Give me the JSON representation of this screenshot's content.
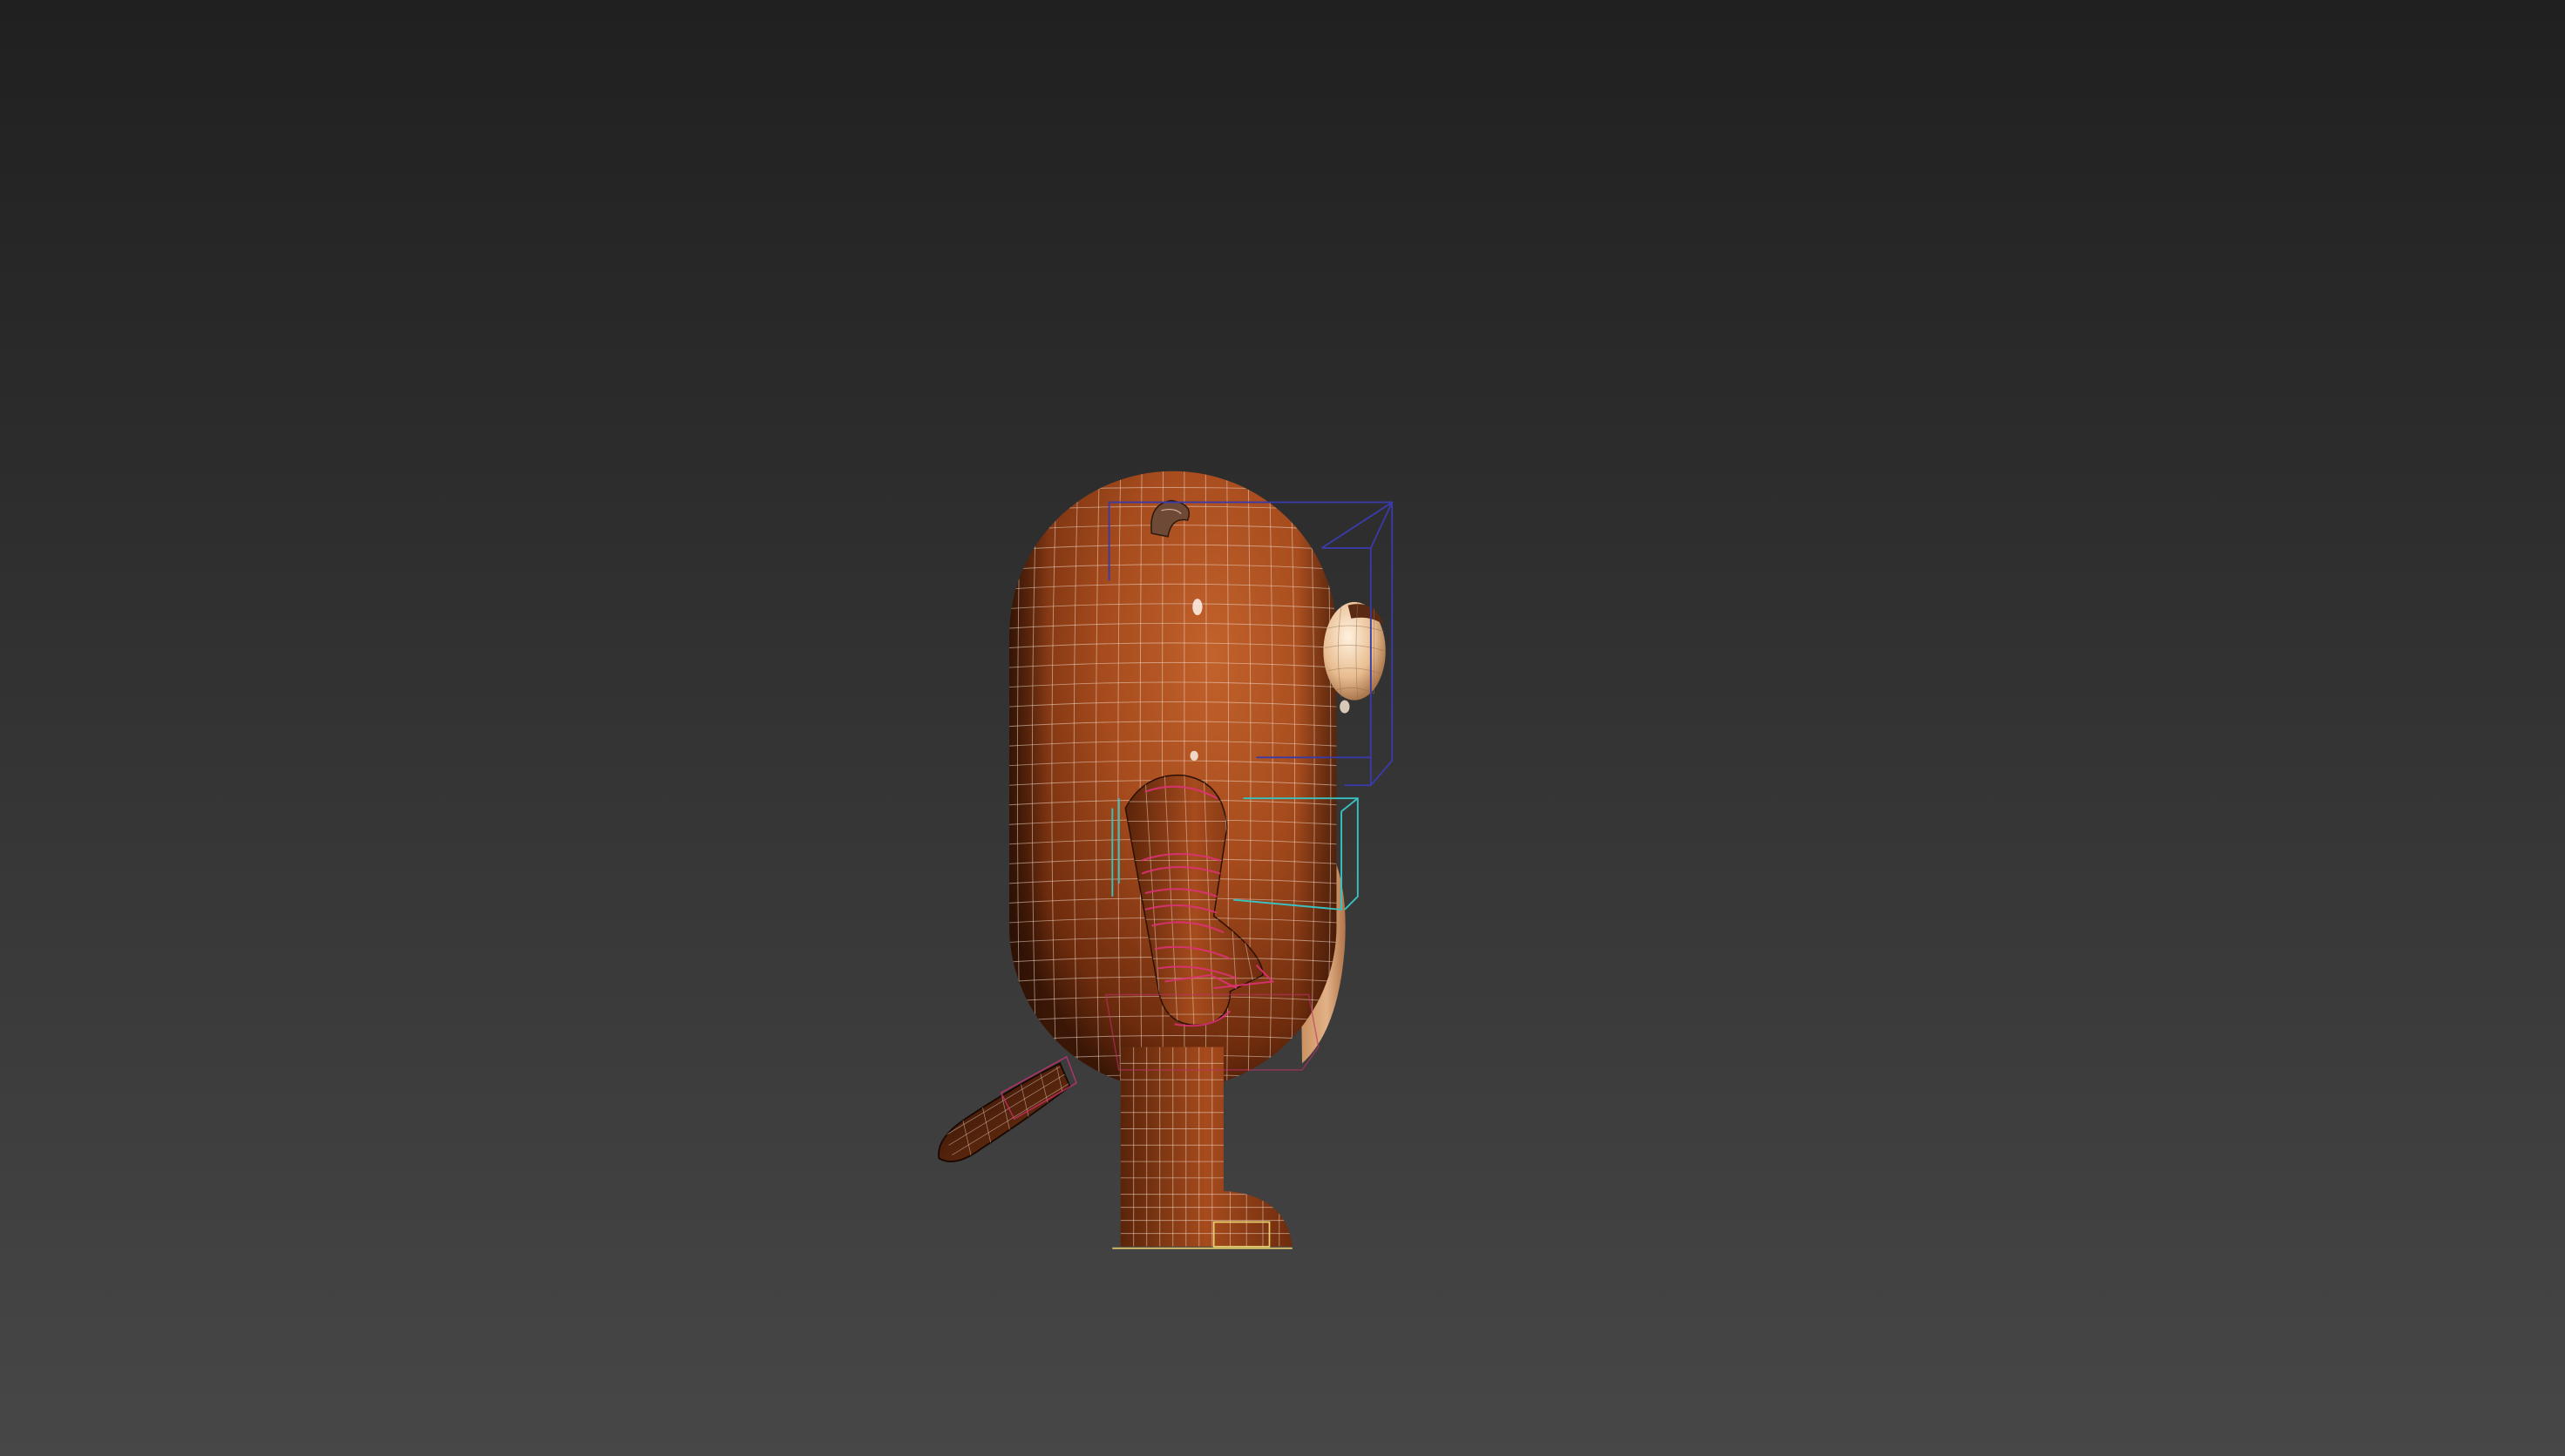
{
  "viewport": {
    "background_top": "#202020",
    "background_bottom": "#474747"
  },
  "character": {
    "body_color": "#a64b1d",
    "belly_color": "#e2b187",
    "shoe_color": "#7a3512",
    "wireframe_color": "#f0d8c8"
  },
  "rig": {
    "head_control_color": "#3a3aa8",
    "chest_control_color": "#38c2c2",
    "arm_control_color": "#e0307a",
    "foot_control_color": "#e8d070"
  }
}
